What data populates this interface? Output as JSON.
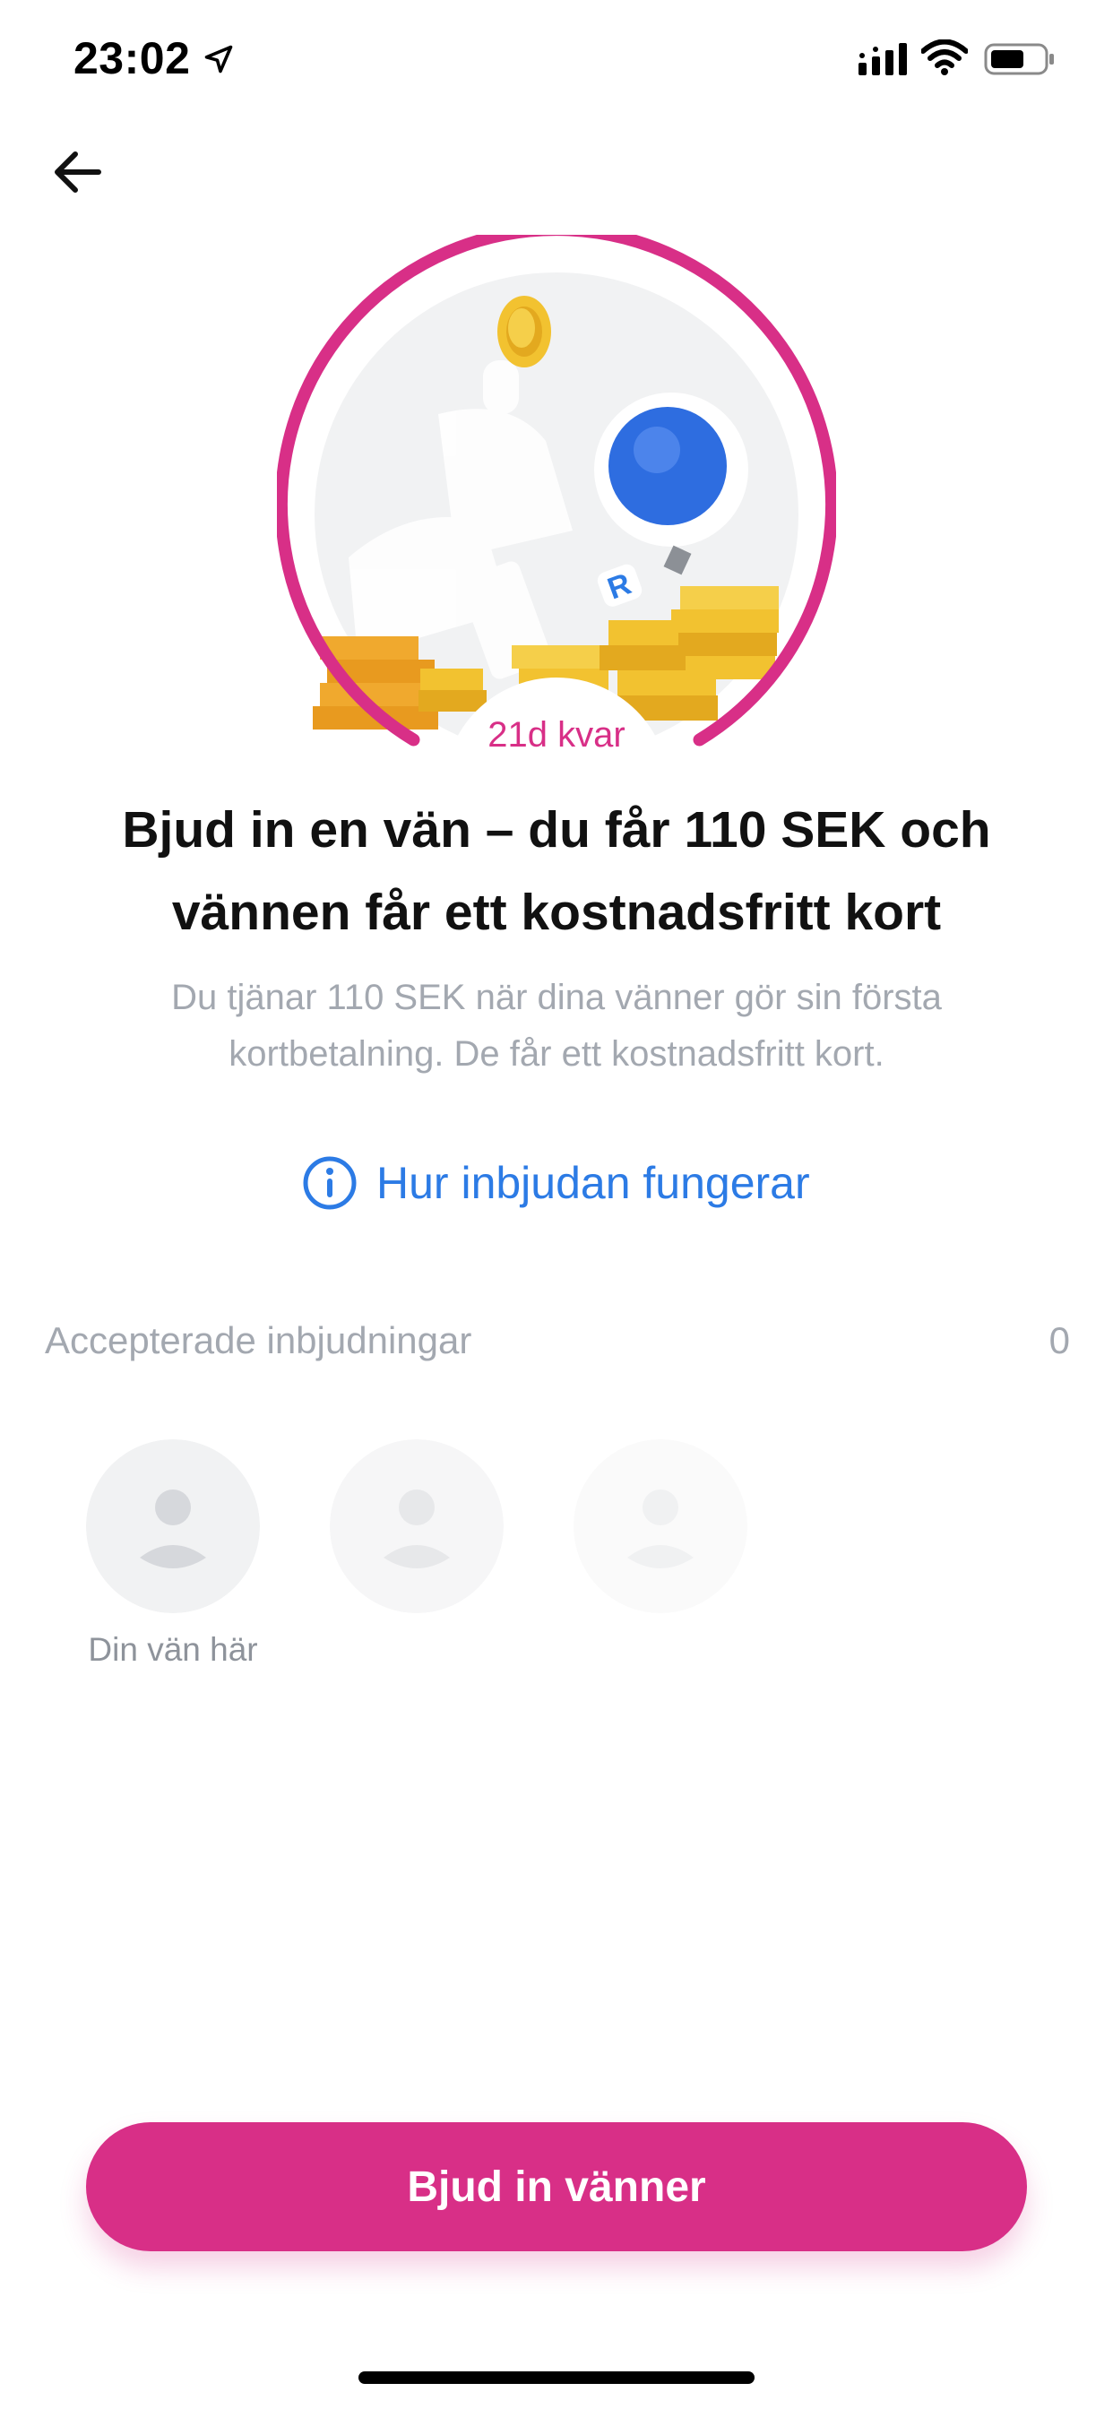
{
  "status_bar": {
    "time": "23:02",
    "icons": [
      "location-arrow-icon",
      "signal-icon",
      "wifi-icon",
      "battery-icon"
    ]
  },
  "header": {
    "back_icon": "back-arrow-icon"
  },
  "hero": {
    "days_left": "21d kvar",
    "ring_color": "#d82f87"
  },
  "content": {
    "headline_line1": "Bjud in en vän – du får 110 SEK och",
    "headline_line2": "vännen får ett kostnadsfritt kort",
    "subtext_line1": "Du tjänar 110 SEK när dina vänner gör sin första",
    "subtext_line2": "kortbetalning. De får ett kostnadsfritt kort.",
    "info_link": "Hur inbjudan fungerar",
    "info_icon": "info-icon"
  },
  "invitations": {
    "label": "Accepterade inbjudningar",
    "count": "0",
    "slots": [
      {
        "caption": "Din vän här",
        "icon": "avatar-placeholder-icon"
      },
      {
        "caption": "",
        "icon": "avatar-placeholder-icon"
      },
      {
        "caption": "",
        "icon": "avatar-placeholder-icon"
      }
    ]
  },
  "cta": {
    "label": "Bjud in vänner"
  },
  "colors": {
    "accent": "#d82f87",
    "link": "#2c7be5",
    "muted_text": "#a3a8b0"
  }
}
